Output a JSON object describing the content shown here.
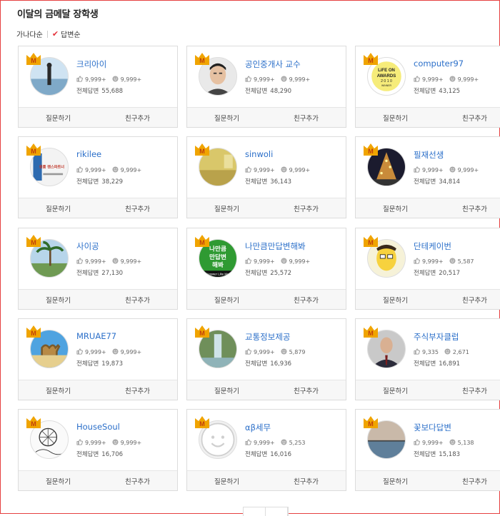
{
  "header": {
    "title": "이달의 금메달 장학생",
    "sort_alpha": "가나다순",
    "sort_answers": "답변순"
  },
  "actions": {
    "ask": "질문하기",
    "friend": "친구추가"
  },
  "total_label": "전체답변",
  "badge_letter": "M",
  "users": [
    {
      "name": "크리아이",
      "likes": "9,999+",
      "smiles": "9,999+",
      "total": "55,688",
      "avatar": "person-lake"
    },
    {
      "name": "공인중개사 교수",
      "likes": "9,999+",
      "smiles": "9,999+",
      "total": "48,290",
      "avatar": "man-portrait"
    },
    {
      "name": "computer97",
      "likes": "9,999+",
      "smiles": "9,999+",
      "total": "43,125",
      "avatar": "lifeon-awards"
    },
    {
      "name": "rikilee",
      "likes": "9,999+",
      "smiles": "9,999+",
      "total": "38,229",
      "avatar": "book-cover"
    },
    {
      "name": "sinwoli",
      "likes": "9,999+",
      "smiles": "9,999+",
      "total": "36,143",
      "avatar": "room"
    },
    {
      "name": "필재선생",
      "likes": "9,999+",
      "smiles": "9,999+",
      "total": "34,814",
      "avatar": "christmas-tree"
    },
    {
      "name": "사이공",
      "likes": "9,999+",
      "smiles": "9,999+",
      "total": "27,130",
      "avatar": "palm-resort"
    },
    {
      "name": "나만큼만답변해봐",
      "likes": "9,999+",
      "smiles": "9,999+",
      "total": "25,572",
      "avatar": "green-text"
    },
    {
      "name": "단테케이번",
      "likes": "9,999+",
      "smiles": "5,587",
      "total": "20,517",
      "avatar": "cartoon"
    },
    {
      "name": "MRUAE77",
      "likes": "9,999+",
      "smiles": "9,999+",
      "total": "19,873",
      "avatar": "camel"
    },
    {
      "name": "교통정보제공",
      "likes": "9,999+",
      "smiles": "5,879",
      "total": "16,936",
      "avatar": "waterfall"
    },
    {
      "name": "주식부자클럽",
      "likes": "9,335",
      "smiles": "2,671",
      "total": "16,891",
      "avatar": "suit-man"
    },
    {
      "name": "HouseSoul",
      "likes": "9,999+",
      "smiles": "9,999+",
      "total": "16,706",
      "avatar": "sketch"
    },
    {
      "name": "αβ세무",
      "likes": "9,999+",
      "smiles": "5,253",
      "total": "16,016",
      "avatar": "default-face"
    },
    {
      "name": "꽃보다답변",
      "likes": "9,999+",
      "smiles": "5,138",
      "total": "15,183",
      "avatar": "sea"
    }
  ],
  "avatar_text": {
    "lifeon": [
      "LiFE ON",
      "AWARDS",
      "2 0 1 0",
      "WINNER"
    ],
    "green": [
      "나만큼",
      "만답변",
      "해봐",
      "Answer Like Me"
    ],
    "book": [
      "원룸 렌스파트너"
    ]
  },
  "colors": {
    "link": "#2b6fc9",
    "badge": "#f0a400",
    "check": "#e4333b"
  }
}
